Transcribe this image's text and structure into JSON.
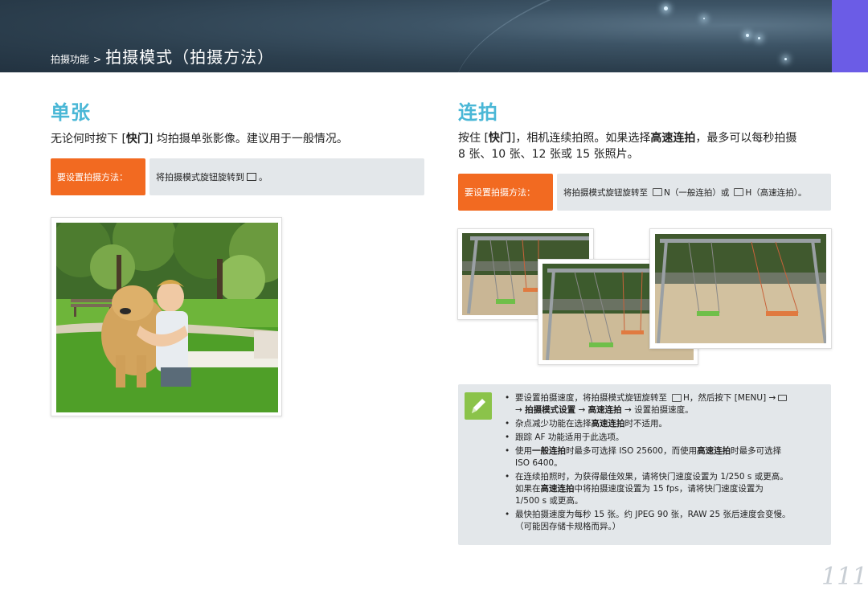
{
  "header": {
    "breadcrumb_parent": "拍摄功能",
    "breadcrumb_sep": ">",
    "breadcrumb_current": "拍摄模式（拍摄方法）"
  },
  "single": {
    "title": "单张",
    "desc_before": "无论何时按下 [",
    "desc_key": "快门",
    "desc_after": "] 均拍摄单张影像。建议用于一般情况。",
    "how_label": "要设置拍摄方法：",
    "how_text": "将拍摄模式旋钮旋转到",
    "how_end": "。"
  },
  "continuous": {
    "title": "连拍",
    "desc_1": "按住 [",
    "desc_key": "快门",
    "desc_2": "]，相机连续拍照。如果选择",
    "desc_bold": "高速连拍",
    "desc_3": "，最多可以每秒拍摄",
    "desc_line2": "8 张、10 张、12 张或 15 张照片。",
    "how_label": "要设置拍摄方法：",
    "how_text_1": "将拍摄模式旋钮旋转至",
    "how_n": "N（一般连拍）或",
    "how_h": "H（高速连拍）。"
  },
  "notes": {
    "n1_a": "要设置拍摄速度，将拍摄模式旋钮旋转至",
    "n1_b": "H，然后按下 [MENU] →",
    "n1_c": "→",
    "n1_bold1": "拍摄模式设置",
    "n1_d": "→",
    "n1_bold2": "高速连拍",
    "n1_e": "→ 设置拍摄速度。",
    "n2_a": "杂点减少功能在选择",
    "n2_bold": "高速连拍",
    "n2_b": "时不适用。",
    "n3": "跟踪 AF 功能适用于此选项。",
    "n4_a": "使用",
    "n4_bold1": "一般连拍",
    "n4_b": "时最多可选择 ISO 25600，而使用",
    "n4_bold2": "高速连拍",
    "n4_c": "时最多可选择",
    "n4_d": "ISO 6400。",
    "n5_a": "在连续拍照时，为获得最佳效果，请将快门速度设置为 1/250 s 或更高。",
    "n5_b": "如果在",
    "n5_bold": "高速连拍",
    "n5_c": "中将拍摄速度设置为 15 fps，请将快门速度设置为",
    "n5_d": "1/500 s 或更高。",
    "n6_a": "最快拍摄速度为每秒 15 张。约 JPEG 90 张，RAW 25 张后速度会变慢。",
    "n6_b": "（可能因存储卡规格而异。）"
  },
  "page_number": "111",
  "colors": {
    "accent_blue": "#49b7d6",
    "orange": "#f26a21",
    "note_bg": "#e3e7ea",
    "tab_purple": "#6b5ce6"
  }
}
